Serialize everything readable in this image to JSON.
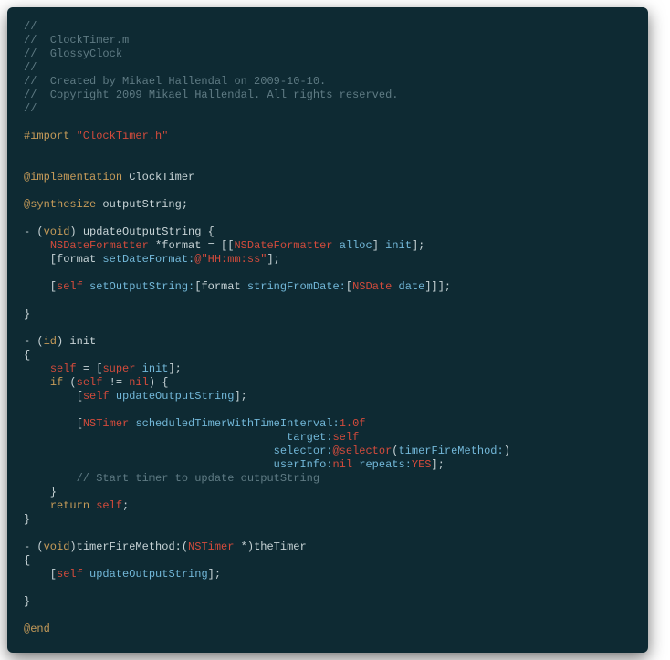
{
  "code": {
    "c1": "//",
    "c2": "//  ClockTimer.m",
    "c3": "//  GlossyClock",
    "c4": "//",
    "c5": "//  Created by Mikael Hallendal on 2009-10-10.",
    "c6": "//  Copyright 2009 Mikael Hallendal. All rights reserved.",
    "c7": "//",
    "import_kw": "#import ",
    "import_str": "\"ClockTimer.h\"",
    "impl_kw": "@implementation",
    "impl_name": " ClockTimer",
    "synth_kw": "@synthesize",
    "synth_name": " outputString;",
    "m1_a": "- (",
    "m1_void": "void",
    "m1_b": ") updateOutputString {",
    "m1_l1_a": "    ",
    "m1_l1_type1": "NSDateFormatter",
    "m1_l1_b": " *format = [[",
    "m1_l1_type2": "NSDateFormatter",
    "m1_l1_c": " ",
    "m1_l1_alloc": "alloc",
    "m1_l1_d": "] ",
    "m1_l1_init": "init",
    "m1_l1_e": "];",
    "m1_l2_a": "    [format ",
    "m1_l2_msg": "setDateFormat:",
    "m1_l2_b": "@",
    "m1_l2_str": "\"HH:mm:ss\"",
    "m1_l2_c": "];",
    "m1_l3_a": "    [",
    "m1_l3_self": "self",
    "m1_l3_b": " ",
    "m1_l3_msg": "setOutputString:",
    "m1_l3_c": "[format ",
    "m1_l3_msg2": "stringFromDate:",
    "m1_l3_d": "[",
    "m1_l3_type": "NSDate",
    "m1_l3_e": " ",
    "m1_l3_date": "date",
    "m1_l3_f": "]]];",
    "m1_close": "}",
    "m2_sig_a": "- (",
    "m2_sig_id": "id",
    "m2_sig_b": ") init",
    "m2_open": "{",
    "m2_l1_a": "    ",
    "m2_l1_self": "self",
    "m2_l1_b": " = [",
    "m2_l1_super": "super",
    "m2_l1_c": " ",
    "m2_l1_init": "init",
    "m2_l1_d": "];",
    "m2_l2_a": "    ",
    "m2_l2_if": "if",
    "m2_l2_b": " (",
    "m2_l2_self": "self",
    "m2_l2_c": " != ",
    "m2_l2_nil": "nil",
    "m2_l2_d": ") {",
    "m2_l3_a": "        [",
    "m2_l3_self": "self",
    "m2_l3_b": " ",
    "m2_l3_msg": "updateOutputString",
    "m2_l3_c": "];",
    "m2_l4_a": "        [",
    "m2_l4_type": "NSTimer",
    "m2_l4_b": " ",
    "m2_l4_msg": "scheduledTimerWithTimeInterval:",
    "m2_l4_num": "1.0f",
    "m2_l5_a": "                                        ",
    "m2_l5_msg": "target:",
    "m2_l5_self": "self",
    "m2_l6_a": "                                      ",
    "m2_l6_msg": "selector:",
    "m2_l6_sel": "@selector",
    "m2_l6_b": "(",
    "m2_l6_fn": "timerFireMethod:",
    "m2_l6_c": ")",
    "m2_l7_a": "                                      ",
    "m2_l7_msg1": "userInfo:",
    "m2_l7_nil": "nil",
    "m2_l7_b": " ",
    "m2_l7_msg2": "repeats:",
    "m2_l7_yes": "YES",
    "m2_l7_c": "];",
    "m2_l8": "        // Start timer to update outputString",
    "m2_l9": "    }",
    "m2_l10_a": "    ",
    "m2_l10_ret": "return",
    "m2_l10_b": " ",
    "m2_l10_self": "self",
    "m2_l10_c": ";",
    "m2_close": "}",
    "m3_sig_a": "- (",
    "m3_sig_void": "void",
    "m3_sig_b": ")timerFireMethod:(",
    "m3_sig_type": "NSTimer",
    "m3_sig_c": " *)theTimer",
    "m3_open": "{",
    "m3_l1_a": "    [",
    "m3_l1_self": "self",
    "m3_l1_b": " ",
    "m3_l1_msg": "updateOutputString",
    "m3_l1_c": "];",
    "m3_close": "}",
    "end_kw": "@end"
  }
}
